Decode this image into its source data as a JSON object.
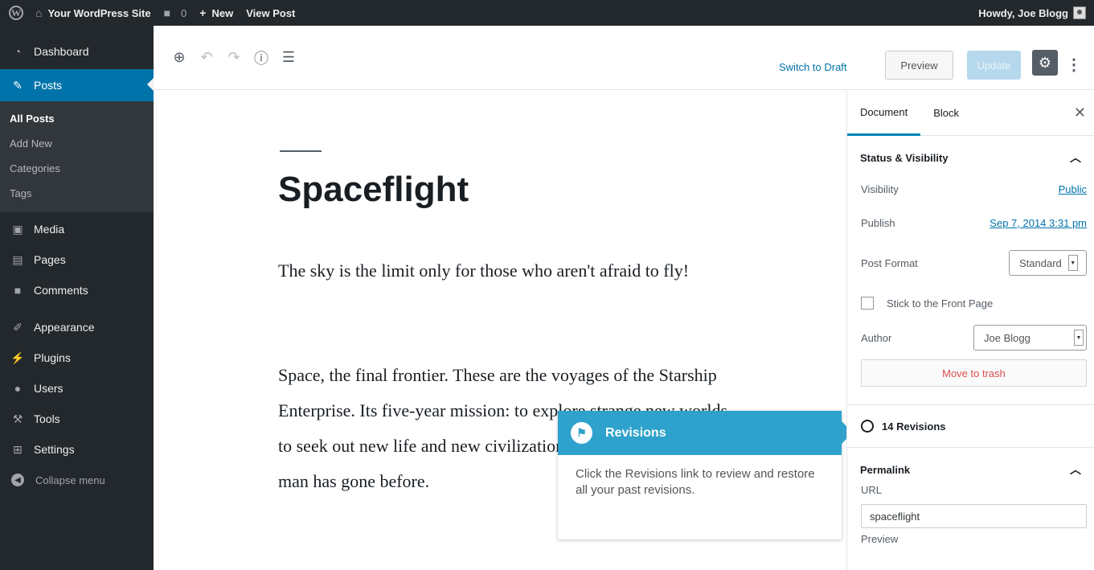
{
  "adminbar": {
    "site_name": "Your WordPress Site",
    "comments_count": "0",
    "new_label": "New",
    "view_post_label": "View Post",
    "howdy": "Howdy, Joe Blogg"
  },
  "sidebar": {
    "dashboard": "Dashboard",
    "posts": "Posts",
    "sub_all_posts": "All Posts",
    "sub_add_new": "Add New",
    "sub_categories": "Categories",
    "sub_tags": "Tags",
    "media": "Media",
    "pages": "Pages",
    "comments": "Comments",
    "appearance": "Appearance",
    "plugins": "Plugins",
    "users": "Users",
    "tools": "Tools",
    "settings": "Settings",
    "collapse": "Collapse menu"
  },
  "toolbar": {
    "switch_to_draft": "Switch to Draft",
    "preview": "Preview",
    "update": "Update"
  },
  "post": {
    "title": "Spaceflight",
    "paragraph1": "The sky is the limit only for those who aren't afraid to fly!",
    "paragraph2": "Space, the final frontier. These are the voyages of the Starship Enterprise. Its five-year mission: to explore strange new worlds, to seek out new life and new civilizations, to boldly go where no man has gone before."
  },
  "tooltip": {
    "title": "Revisions",
    "body": "Click the Revisions link to review and restore all your past revisions."
  },
  "panel": {
    "tab_document": "Document",
    "tab_block": "Block",
    "status_heading": "Status & Visibility",
    "visibility_label": "Visibility",
    "visibility_value": "Public",
    "publish_label": "Publish",
    "publish_value": "Sep 7, 2014 3:31 pm",
    "post_format_label": "Post Format",
    "post_format_value": "Standard",
    "stick_label": "Stick to the Front Page",
    "author_label": "Author",
    "author_value": "Joe Blogg",
    "trash_label": "Move to trash",
    "revisions_label": "14 Revisions",
    "permalink_heading": "Permalink",
    "url_label": "URL",
    "url_value": "spaceflight",
    "preview_label": "Preview"
  },
  "colors": {
    "admin_bg": "#23282d",
    "accent": "#0073aa",
    "tooltip": "#2ea2cc"
  }
}
